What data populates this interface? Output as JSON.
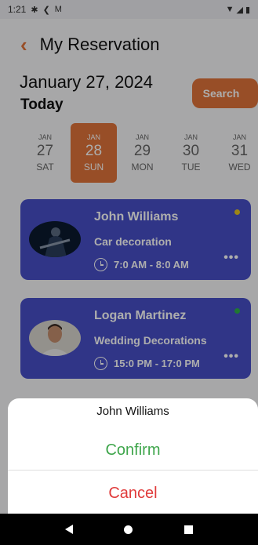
{
  "status_bar": {
    "time": "1:21",
    "icons_left": [
      "settings-icon",
      "flutter-icon",
      "gmail-icon"
    ],
    "icons_right": [
      "wifi-icon",
      "signal-icon",
      "battery-icon"
    ]
  },
  "header": {
    "title": "My Reservation"
  },
  "date": {
    "title": "January 27, 2024",
    "subtitle": "Today"
  },
  "search_label": "Search",
  "days": [
    {
      "month": "JAN",
      "day": "27",
      "weekday": "SAT"
    },
    {
      "month": "JAN",
      "day": "28",
      "weekday": "SUN"
    },
    {
      "month": "JAN",
      "day": "29",
      "weekday": "MON"
    },
    {
      "month": "JAN",
      "day": "30",
      "weekday": "TUE"
    },
    {
      "month": "JAN",
      "day": "31",
      "weekday": "WED"
    }
  ],
  "reservations": [
    {
      "name": "John Williams",
      "service": "Car decoration",
      "time": "7:0 AM - 8:0 AM",
      "status_color": "#e8c520"
    },
    {
      "name": "Logan Martinez",
      "service": "Wedding Decorations",
      "time": "15:0 PM - 17:0 PM",
      "status_color": "#2fb24a"
    }
  ],
  "sheet": {
    "title": "John Williams",
    "confirm_label": "Confirm",
    "cancel_label": "Cancel"
  },
  "colors": {
    "accent": "#e0743a",
    "card": "#474fc8",
    "confirm": "#3fa64c",
    "cancel": "#e03a3a"
  }
}
